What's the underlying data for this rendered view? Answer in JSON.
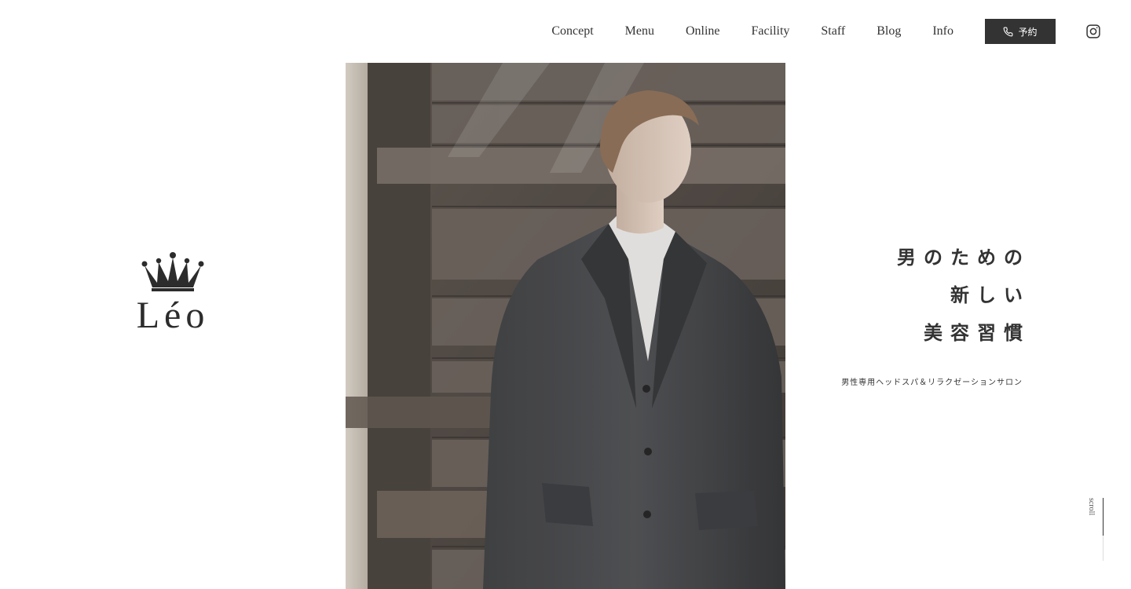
{
  "nav": {
    "items": [
      "Concept",
      "Menu",
      "Online",
      "Facility",
      "Staff",
      "Blog",
      "Info"
    ],
    "reserve_label": "予約",
    "reserve_icon": "phone-icon",
    "social_icon": "instagram-icon"
  },
  "logo": {
    "text": "Léo",
    "icon": "crown-icon"
  },
  "hero": {
    "catch_lines": [
      "男のための",
      "新しい",
      "美容習慣"
    ],
    "subtitle": "男性専用ヘッドスパ＆リラクゼーションサロン"
  },
  "scroll": {
    "label": "scroll"
  },
  "colors": {
    "text": "#333333",
    "button_bg": "#333333",
    "button_text": "#ffffff",
    "background": "#ffffff"
  }
}
